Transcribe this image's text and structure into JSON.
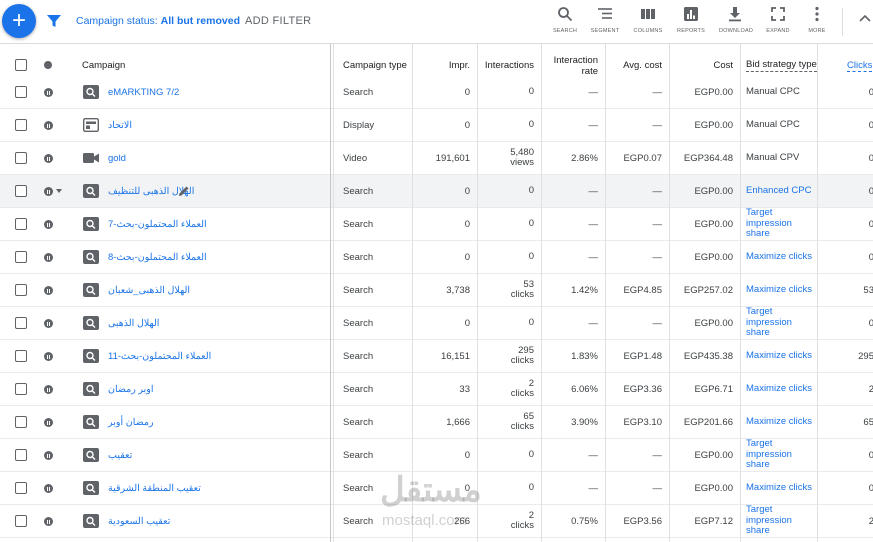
{
  "toolbar": {
    "add_icon": "plus-icon",
    "filter_icon": "funnel-icon",
    "status_label": "Campaign status:",
    "status_value": "All but removed",
    "add_filter": "ADD FILTER",
    "tools": [
      {
        "icon": "search-icon",
        "label": "SEARCH"
      },
      {
        "icon": "segment-icon",
        "label": "SEGMENT"
      },
      {
        "icon": "columns-icon",
        "label": "COLUMNS"
      },
      {
        "icon": "reports-icon",
        "label": "REPORTS"
      },
      {
        "icon": "download-icon",
        "label": "DOWNLOAD"
      },
      {
        "icon": "expand-icon",
        "label": "EXPAND"
      },
      {
        "icon": "more-icon",
        "label": "MORE"
      }
    ],
    "collapse_icon": "chevron-up-icon"
  },
  "columns": {
    "campaign": "Campaign",
    "campaign_type": "Campaign type",
    "impr": "Impr.",
    "interactions": "Interactions",
    "interaction_rate": "Interaction rate",
    "avg_cost": "Avg. cost",
    "cost": "Cost",
    "bid_strategy": "Bid strategy type",
    "clicks": "Clicks"
  },
  "rows": [
    {
      "name": "eMARKTING 7/2",
      "type": "Search",
      "impr": "0",
      "interactions": "0",
      "interactions_unit": "",
      "rate": "—",
      "avg_cost": "—",
      "cost": "EGP0.00",
      "bid": "Manual CPC",
      "bid_link": false,
      "clicks": "0",
      "icon": "search-campaign-icon"
    },
    {
      "name": "الاتحاد",
      "type": "Display",
      "impr": "0",
      "interactions": "0",
      "interactions_unit": "",
      "rate": "—",
      "avg_cost": "—",
      "cost": "EGP0.00",
      "bid": "Manual CPC",
      "bid_link": false,
      "clicks": "0",
      "icon": "display-campaign-icon"
    },
    {
      "name": "gold",
      "type": "Video",
      "impr": "191,601",
      "interactions": "5,480",
      "interactions_unit": "views",
      "rate": "2.86%",
      "avg_cost": "EGP0.07",
      "cost": "EGP364.48",
      "bid": "Manual CPV",
      "bid_link": false,
      "clicks": "0",
      "icon": "video-campaign-icon"
    },
    {
      "name": "الهلال الذهبى للتنظيف",
      "type": "Search",
      "impr": "0",
      "interactions": "0",
      "interactions_unit": "",
      "rate": "—",
      "avg_cost": "—",
      "cost": "EGP0.00",
      "bid": "Enhanced CPC",
      "bid_link": true,
      "clicks": "0",
      "icon": "search-campaign-icon"
    },
    {
      "name": "العملاء المحتملون-بحث-7",
      "type": "Search",
      "impr": "0",
      "interactions": "0",
      "interactions_unit": "",
      "rate": "—",
      "avg_cost": "—",
      "cost": "EGP0.00",
      "bid": "Target impression share",
      "bid_link": true,
      "clicks": "0",
      "icon": "search-campaign-icon"
    },
    {
      "name": "العملاء المحتملون-بحث-8",
      "type": "Search",
      "impr": "0",
      "interactions": "0",
      "interactions_unit": "",
      "rate": "—",
      "avg_cost": "—",
      "cost": "EGP0.00",
      "bid": "Maximize clicks",
      "bid_link": true,
      "clicks": "0",
      "icon": "search-campaign-icon"
    },
    {
      "name": "الهلال الذهبى_شعبان",
      "type": "Search",
      "impr": "3,738",
      "interactions": "53",
      "interactions_unit": "clicks",
      "rate": "1.42%",
      "avg_cost": "EGP4.85",
      "cost": "EGP257.02",
      "bid": "Maximize clicks",
      "bid_link": true,
      "clicks": "53",
      "icon": "search-campaign-icon"
    },
    {
      "name": "الهلال الذهبى",
      "type": "Search",
      "impr": "0",
      "interactions": "0",
      "interactions_unit": "",
      "rate": "—",
      "avg_cost": "—",
      "cost": "EGP0.00",
      "bid": "Target impression share",
      "bid_link": true,
      "clicks": "0",
      "icon": "search-campaign-icon"
    },
    {
      "name": "العملاء المحتملون-بحث-11",
      "type": "Search",
      "impr": "16,151",
      "interactions": "295",
      "interactions_unit": "clicks",
      "rate": "1.83%",
      "avg_cost": "EGP1.48",
      "cost": "EGP435.38",
      "bid": "Maximize clicks",
      "bid_link": true,
      "clicks": "295",
      "icon": "search-campaign-icon"
    },
    {
      "name": "اوبر رمضان",
      "type": "Search",
      "impr": "33",
      "interactions": "2",
      "interactions_unit": "clicks",
      "rate": "6.06%",
      "avg_cost": "EGP3.36",
      "cost": "EGP6.71",
      "bid": "Maximize clicks",
      "bid_link": true,
      "clicks": "2",
      "icon": "search-campaign-icon"
    },
    {
      "name": "رمضان أوبر",
      "type": "Search",
      "impr": "1,666",
      "interactions": "65",
      "interactions_unit": "clicks",
      "rate": "3.90%",
      "avg_cost": "EGP3.10",
      "cost": "EGP201.66",
      "bid": "Maximize clicks",
      "bid_link": true,
      "clicks": "65",
      "icon": "search-campaign-icon"
    },
    {
      "name": "تعقيب",
      "type": "Search",
      "impr": "0",
      "interactions": "0",
      "interactions_unit": "",
      "rate": "—",
      "avg_cost": "—",
      "cost": "EGP0.00",
      "bid": "Target impression share",
      "bid_link": true,
      "clicks": "0",
      "icon": "search-campaign-icon"
    },
    {
      "name": "تعقيب المنطقة الشرقية",
      "type": "Search",
      "impr": "0",
      "interactions": "0",
      "interactions_unit": "",
      "rate": "—",
      "avg_cost": "—",
      "cost": "EGP0.00",
      "bid": "Maximize clicks",
      "bid_link": true,
      "clicks": "0",
      "icon": "search-campaign-icon"
    },
    {
      "name": "تعقيب السعودية",
      "type": "Search",
      "impr": "266",
      "interactions": "2",
      "interactions_unit": "clicks",
      "rate": "0.75%",
      "avg_cost": "EGP3.56",
      "cost": "EGP7.12",
      "bid": "Target impression share",
      "bid_link": true,
      "clicks": "2",
      "icon": "search-campaign-icon"
    }
  ],
  "watermark": {
    "arabic": "مستقل",
    "latin": "mostaql.com"
  },
  "colors": {
    "accent": "#1a73e8",
    "text": "#3c4043",
    "border": "#dadce0",
    "highlight_row": "#f1f3f4"
  }
}
